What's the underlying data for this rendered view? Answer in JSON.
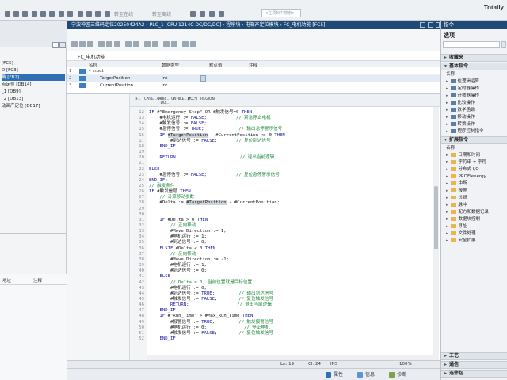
{
  "app": {
    "brand": "Totally"
  },
  "toolbar": {
    "items": [
      "转至在线",
      "转至离线"
    ],
    "search_placeholder": "<在项目中搜索>"
  },
  "left_pane": {
    "items": [
      {
        "text": "[FC5]",
        "selected": false
      },
      {
        "text": "D [FC3]",
        "selected": false
      },
      {
        "text": "角 [FB2]",
        "selected": true
      },
      {
        "text": "点定位 [DB14]",
        "selected": false
      },
      {
        "text": "_1 [DB9]",
        "selected": false
      },
      {
        "text": "_2 [DB13]",
        "selected": false
      },
      {
        "text": "动画产定位 [DB17]",
        "selected": false
      }
    ],
    "lower_headers": [
      "地址",
      "注释"
    ]
  },
  "editor": {
    "window_title": "宁波神匠三维码定位20250424A2 › PLC_1 [CPU 1214C DC/DC/DC] › 程序块 › 电箱产定位模块 › FC_电机功能 [FC5]",
    "block_title": "FC_电机功能",
    "iface_headers": [
      "名称",
      "数据类型",
      "默认值",
      "注释"
    ],
    "iface_rows": [
      {
        "num": "1",
        "name": "▾ Input",
        "type": "",
        "selected": false
      },
      {
        "num": "2",
        "name": "TargetPosition",
        "type": "Int",
        "selected": true
      },
      {
        "num": "3",
        "name": "CurrentPosition",
        "type": "Int",
        "selected": false
      }
    ],
    "tabs": [
      "IF...",
      "CASE...OF...",
      "FOR...TO DO...",
      "WHILE...DO...",
      "(*...*)",
      "REGION"
    ],
    "code": [
      {
        "n": "12",
        "parts": [
          [
            "kw",
            "IF "
          ],
          [
            "code",
            "#\"Emergency Stop\" OR #触发信号=0 "
          ],
          [
            "kw",
            "THEN"
          ]
        ]
      },
      {
        "n": "13",
        "parts": [
          [
            "code",
            "    #电机运行 := "
          ],
          [
            "kw",
            "FALSE"
          ],
          [
            "code",
            ";           "
          ],
          [
            "cm",
            "// 紧急停止电机"
          ]
        ]
      },
      {
        "n": "14",
        "parts": [
          [
            "code",
            "    #触发信号 := "
          ],
          [
            "kw",
            "FALSE"
          ],
          [
            "code",
            ";"
          ]
        ]
      },
      {
        "n": "15",
        "parts": [
          [
            "code",
            "    #急停信号 := "
          ],
          [
            "kw",
            "TRUE"
          ],
          [
            "code",
            ";             "
          ],
          [
            "cm",
            "// 输出急停警示信号"
          ]
        ]
      },
      {
        "n": "16",
        "parts": [
          [
            "code",
            "    "
          ],
          [
            "kw",
            "IF "
          ],
          [
            "hl",
            "#TargetPosition"
          ],
          [
            "code",
            " - #CurrentPosition <> 0 "
          ],
          [
            "kw",
            "THEN"
          ]
        ]
      },
      {
        "n": "17",
        "parts": [
          [
            "code",
            "        #到达信号 := "
          ],
          [
            "kw",
            "FALSE"
          ],
          [
            "code",
            ";       "
          ],
          [
            "cm",
            "// 复位到达信号"
          ]
        ]
      },
      {
        "n": "18",
        "parts": [
          [
            "code",
            "    "
          ],
          [
            "kw",
            "END_IF"
          ],
          [
            "code",
            ";"
          ]
        ]
      },
      {
        "n": "19",
        "parts": [
          [
            "code",
            ""
          ]
        ]
      },
      {
        "n": "20",
        "parts": [
          [
            "code",
            "    "
          ],
          [
            "kw",
            "RETURN"
          ],
          [
            "code",
            ";                       "
          ],
          [
            "cm",
            "// 退出当前逻辑"
          ]
        ]
      },
      {
        "n": "21",
        "parts": [
          [
            "code",
            ""
          ]
        ]
      },
      {
        "n": "22",
        "parts": [
          [
            "kw",
            "ELSE"
          ]
        ]
      },
      {
        "n": "23",
        "parts": [
          [
            "code",
            "    #急停信号 := "
          ],
          [
            "kw",
            "FALSE"
          ],
          [
            "code",
            ";           "
          ],
          [
            "cm",
            "// 复位急停警示信号"
          ]
        ]
      },
      {
        "n": "24",
        "parts": [
          [
            "kw",
            "END_IF"
          ],
          [
            "code",
            ";"
          ]
        ]
      },
      {
        "n": "25",
        "parts": [
          [
            "cm",
            "// 触发条件"
          ]
        ]
      },
      {
        "n": "26",
        "parts": [
          [
            "kw",
            "IF "
          ],
          [
            "code",
            "#触发信号 "
          ],
          [
            "kw",
            "THEN"
          ]
        ]
      },
      {
        "n": "27",
        "parts": [
          [
            "code",
            "    "
          ],
          [
            "cm",
            "// 计算移动参数"
          ]
        ]
      },
      {
        "n": "28",
        "parts": [
          [
            "code",
            "    #Delta := "
          ],
          [
            "hl",
            "#TargetPosition"
          ],
          [
            "code",
            " - #CurrentPosition;"
          ]
        ]
      },
      {
        "n": "29",
        "parts": [
          [
            "code",
            ""
          ]
        ]
      },
      {
        "n": "30",
        "parts": [
          [
            "code",
            ""
          ]
        ]
      },
      {
        "n": "31",
        "parts": [
          [
            "code",
            "    "
          ],
          [
            "kw",
            "IF "
          ],
          [
            "code",
            "#Delta > 0 "
          ],
          [
            "kw",
            "THEN"
          ]
        ]
      },
      {
        "n": "32",
        "parts": [
          [
            "code",
            "        "
          ],
          [
            "cm",
            "// 正向移动"
          ]
        ]
      },
      {
        "n": "33",
        "parts": [
          [
            "code",
            "        #Move_Direction := 1;"
          ]
        ]
      },
      {
        "n": "34",
        "parts": [
          [
            "code",
            "        #电机运行 := 1;"
          ]
        ]
      },
      {
        "n": "35",
        "parts": [
          [
            "code",
            "        #到达信号 := 0;"
          ]
        ]
      },
      {
        "n": "36",
        "parts": [
          [
            "code",
            "    "
          ],
          [
            "kw",
            "ELSIF "
          ],
          [
            "code",
            "#Delta < 0 "
          ],
          [
            "kw",
            "THEN"
          ]
        ]
      },
      {
        "n": "37",
        "parts": [
          [
            "code",
            "        "
          ],
          [
            "cm",
            "// 反向移动"
          ]
        ]
      },
      {
        "n": "38",
        "parts": [
          [
            "code",
            "        #Move_Direction := -1;"
          ]
        ]
      },
      {
        "n": "39",
        "parts": [
          [
            "code",
            "        #电机运行 := 1;"
          ]
        ]
      },
      {
        "n": "40",
        "parts": [
          [
            "code",
            "        #到达信号 := 0;"
          ]
        ]
      },
      {
        "n": "41",
        "parts": [
          [
            "code",
            "    "
          ],
          [
            "kw",
            "ELSE"
          ]
        ]
      },
      {
        "n": "42",
        "parts": [
          [
            "code",
            "        "
          ],
          [
            "cm",
            "// Delta = 0, 当前位置就是目标位置"
          ]
        ]
      },
      {
        "n": "43",
        "parts": [
          [
            "code",
            "        #电机运行 := 0;"
          ]
        ]
      },
      {
        "n": "44",
        "parts": [
          [
            "code",
            "        #到达信号 := "
          ],
          [
            "kw",
            "TRUE"
          ],
          [
            "code",
            ";         "
          ],
          [
            "cm",
            "// 输出到达信号"
          ]
        ]
      },
      {
        "n": "45",
        "parts": [
          [
            "code",
            "        #触发信号 := "
          ],
          [
            "kw",
            "FALSE"
          ],
          [
            "code",
            ";        "
          ],
          [
            "cm",
            "// 复位触发信号"
          ]
        ]
      },
      {
        "n": "46",
        "parts": [
          [
            "code",
            "        "
          ],
          [
            "kw",
            "RETURN"
          ],
          [
            "code",
            ";                  "
          ],
          [
            "cm",
            "// 退出当前逻辑"
          ]
        ]
      },
      {
        "n": "47",
        "parts": [
          [
            "code",
            "    "
          ],
          [
            "kw",
            "END_IF"
          ],
          [
            "code",
            ";"
          ]
        ]
      },
      {
        "n": "48",
        "parts": [
          [
            "code",
            "    "
          ],
          [
            "kw",
            "IF "
          ],
          [
            "code",
            "#\"Run_Time\" > #Max_Run_Time "
          ],
          [
            "kw",
            "THEN"
          ]
        ]
      },
      {
        "n": "49",
        "parts": [
          [
            "code",
            "        #报警信号 := "
          ],
          [
            "kw",
            "TRUE"
          ],
          [
            "code",
            ";         "
          ],
          [
            "cm",
            "// 触发报警信号"
          ]
        ]
      },
      {
        "n": "50",
        "parts": [
          [
            "code",
            "        #电机运行 := 0;              "
          ],
          [
            "cm",
            "// 停止电机"
          ]
        ]
      },
      {
        "n": "51",
        "parts": [
          [
            "code",
            "        #触发信号 := "
          ],
          [
            "kw",
            "FALSE"
          ],
          [
            "code",
            ";        "
          ],
          [
            "cm",
            "// 复位触发信号"
          ]
        ]
      },
      {
        "n": "52",
        "parts": [
          [
            "code",
            "    "
          ],
          [
            "kw",
            "END_IF"
          ],
          [
            "code",
            ";"
          ]
        ]
      }
    ],
    "status": {
      "ln": "Ln: 19",
      "cl": "Cl: 24",
      "ins": "INS",
      "zoom": "100%"
    },
    "bottom_tabs": [
      "属性",
      "信息",
      "诊断"
    ]
  },
  "instructions_panel": {
    "title": "指令",
    "options_label": "选项",
    "sections": [
      {
        "label": "收藏夹",
        "collapsed": true
      },
      {
        "label": "基本指令",
        "collapsed": false
      },
      {
        "label": "扩展指令",
        "collapsed": false
      }
    ],
    "basic_items": [
      "名称",
      "位逻辑运算",
      "定时器操作",
      "计数器操作",
      "比较操作",
      "数学函数",
      "移动操作",
      "转换操作",
      "程序控制指令"
    ],
    "extended_items": [
      "名称",
      "日期和时间",
      "字符串 + 字符",
      "分布式 I/O",
      "PROFIenergy",
      "中断",
      "报警",
      "诊断",
      "脉冲",
      "配方和数据记录",
      "数据块控制",
      "寻址",
      "文件处理",
      "安全扩展"
    ],
    "bottom_sections": [
      "工艺",
      "通信",
      "选件包"
    ]
  }
}
